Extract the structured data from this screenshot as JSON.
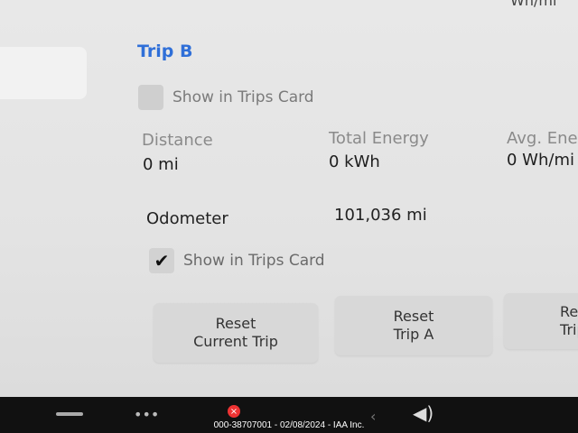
{
  "header": {
    "top_fragment": "Wh/mi"
  },
  "trip_b": {
    "title": "Trip B",
    "show_in_trips_card": "Show in Trips Card",
    "stats": [
      {
        "label": "Distance",
        "value": "0 mi"
      },
      {
        "label": "Total Energy",
        "value": "0 kWh"
      },
      {
        "label": "Avg. Energy",
        "value": "0 Wh/mi"
      }
    ]
  },
  "odometer": {
    "label": "Odometer",
    "value": "101,036 mi",
    "show_in_trips_card": "Show in Trips Card",
    "checked": true
  },
  "buttons": {
    "reset_current_line1": "Reset",
    "reset_current_line2": "Current Trip",
    "reset_a_line1": "Reset",
    "reset_a_line2": "Trip A",
    "reset_b_line1": "Reset",
    "reset_b_line2": "Trip B"
  },
  "taskbar": {
    "caption": "000-38707001 - 02/08/2024 - IAA Inc.",
    "badge": "×",
    "icons": [
      "menu-icon",
      "apps-icon",
      "chevron-left-icon",
      "volume-icon"
    ]
  }
}
